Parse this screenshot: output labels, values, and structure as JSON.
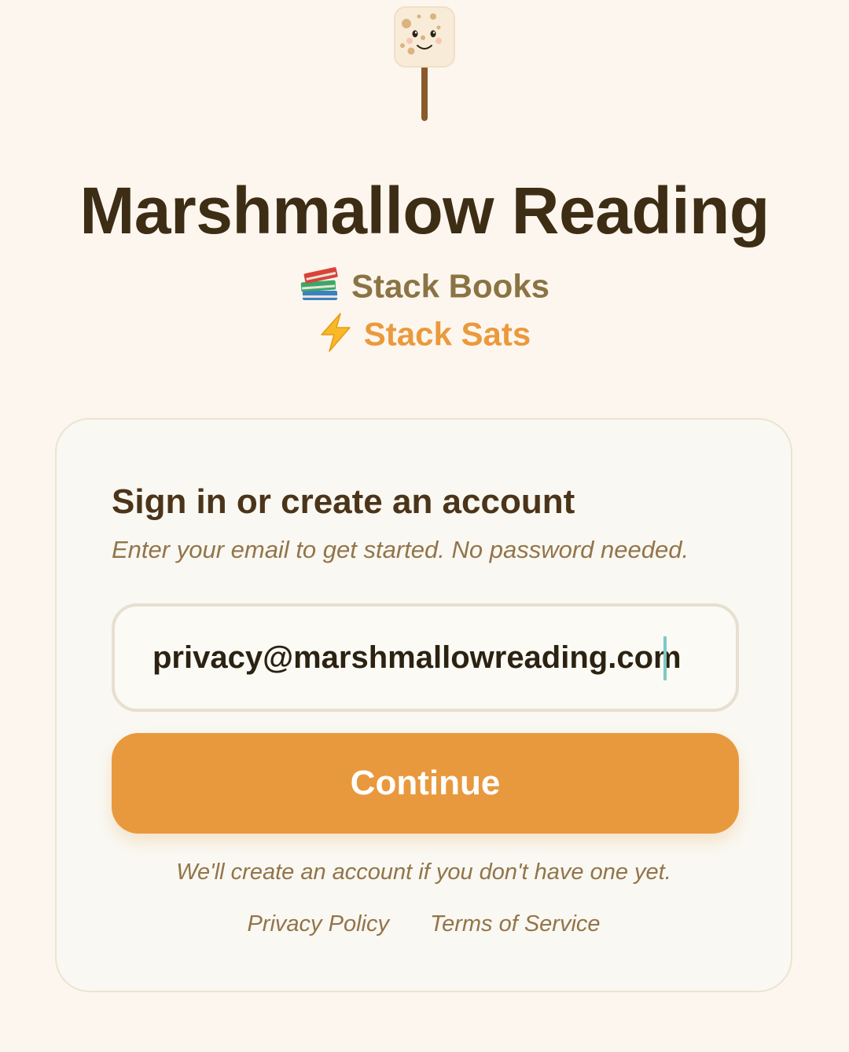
{
  "app": {
    "title": "Marshmallow Reading",
    "tagline_books": "Stack Books",
    "tagline_sats": "Stack Sats",
    "tagline_books_icon": "books-emoji-icon",
    "tagline_sats_icon": "lightning-emoji-icon",
    "logo_icon": "marshmallow-on-stick-icon"
  },
  "signin": {
    "heading": "Sign in or create an account",
    "subtitle": "Enter your email to get started. No password needed.",
    "email_value": "privacy@marshmallowreading.com",
    "continue_label": "Continue",
    "create_note": "We'll create an account if you don't have one yet.",
    "privacy_link": "Privacy Policy",
    "terms_link": "Terms of Service"
  },
  "colors": {
    "background": "#fdf6ee",
    "card": "#f9f8f2",
    "title": "#3d2d14",
    "accent_orange": "#e8993e",
    "muted_brown": "#93744a",
    "caret": "#7ec9c6"
  }
}
